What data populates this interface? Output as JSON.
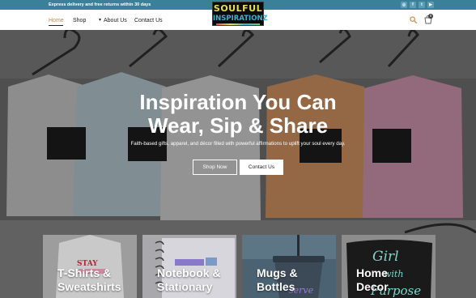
{
  "topbar": {
    "announcement": "Express delivery and free returns within 30 days",
    "social_icons": [
      "instagram-icon",
      "facebook-icon",
      "twitter-icon",
      "youtube-icon"
    ],
    "social_glyphs": [
      "◎",
      "f",
      "t",
      "▶"
    ]
  },
  "header": {
    "nav": [
      "Home",
      "Shop",
      "About Us",
      "Contact Us"
    ],
    "logo_line1": "SOULFUL",
    "logo_line2": "INSPIRATIONZ",
    "cart_count": "0"
  },
  "hero": {
    "title_line1": "Inspiration You Can",
    "title_line2": "Wear, Sip & Share",
    "subtitle": "Faith-based gifts, apparel, and décor filled with powerful affirmations to uplift your soul every day.",
    "shop_button": "Shop Now",
    "contact_button": "Contact Us"
  },
  "categories": [
    {
      "line1": "T-Shirts &",
      "line2": "Sweatshirts"
    },
    {
      "line1": "Notebook &",
      "line2": "Stationary"
    },
    {
      "line1": "Mugs &",
      "line2": "Bottles"
    },
    {
      "line1": "Home",
      "line2": "Decor"
    }
  ],
  "colors": {
    "topbar": "#3a8098",
    "accent": "#c98a4a"
  }
}
